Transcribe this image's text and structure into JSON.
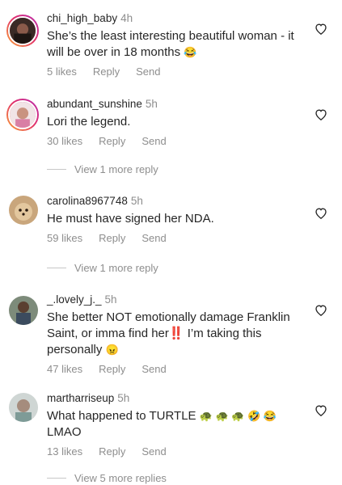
{
  "comments": [
    {
      "username": "chi_high_baby",
      "time": "4h",
      "text": "She’s the least interesting beautiful woman - it will be over in 18 months",
      "emoji": "😂",
      "likes": "5 likes",
      "reply": "Reply",
      "send": "Send"
    },
    {
      "username": "abundant_sunshine",
      "time": "5h",
      "text": "Lori the legend.",
      "likes": "30 likes",
      "reply": "Reply",
      "send": "Send",
      "view_more": "View 1 more reply"
    },
    {
      "username": "carolina8967748",
      "time": "5h",
      "text": "He must have signed her NDA.",
      "likes": "59 likes",
      "reply": "Reply",
      "send": "Send",
      "view_more": "View 1 more reply"
    },
    {
      "username": "_.lovely_j._",
      "time": "5h",
      "text_part1": "She better NOT emotionally damage Franklin Saint, or imma find her",
      "bang": "‼️",
      "text_part2": " I’m taking this personally",
      "emoji": "😠",
      "likes": "47 likes",
      "reply": "Reply",
      "send": "Send"
    },
    {
      "username": "martharriseup",
      "time": "5h",
      "text": "What happened to TURTLE",
      "emoji": "🐢 🐢 🐢  🤣 😂",
      "text_part2": "LMAO",
      "likes": "13 likes",
      "reply": "Reply",
      "send": "Send",
      "view_more": "View 5 more replies"
    }
  ],
  "icons": {
    "heart": "heart-outline-icon"
  },
  "colors": {
    "text": "#262626",
    "secondary": "#8e8e8e",
    "story_ring": "#e1306c"
  }
}
